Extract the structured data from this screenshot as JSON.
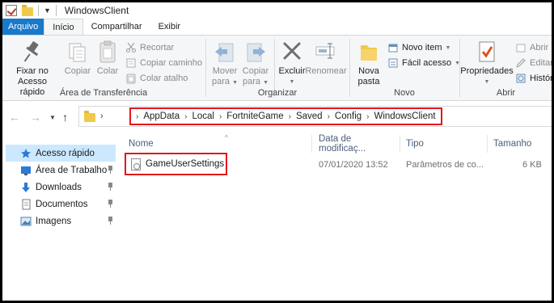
{
  "window": {
    "title": "WindowsClient"
  },
  "tabs": [
    {
      "label": "Arquivo"
    },
    {
      "label": "Início"
    },
    {
      "label": "Compartilhar"
    },
    {
      "label": "Exibir"
    }
  ],
  "ribbon": {
    "clipboard": {
      "group_label": "Área de Transferência",
      "pin_label_1": "Fixar no",
      "pin_label_2": "Acesso rápido",
      "copy_label": "Copiar",
      "paste_label": "Colar",
      "cut_label": "Recortar",
      "copy_path_label": "Copiar caminho",
      "paste_shortcut_label": "Colar atalho"
    },
    "organize": {
      "group_label": "Organizar",
      "move_label_1": "Mover",
      "move_label_2": "para",
      "copyto_label_1": "Copiar",
      "copyto_label_2": "para",
      "delete_label": "Excluir",
      "rename_label": "Renomear"
    },
    "new": {
      "group_label": "Novo",
      "new_folder_label_1": "Nova",
      "new_folder_label_2": "pasta",
      "new_item_label": "Novo item",
      "easy_access_label": "Fácil acesso"
    },
    "open": {
      "group_label": "Abrir",
      "properties_label": "Propriedades",
      "open_label": "Abrir",
      "edit_label": "Editar",
      "history_label": "Históri"
    }
  },
  "address": {
    "crumbs": [
      "AppData",
      "Local",
      "FortniteGame",
      "Saved",
      "Config",
      "WindowsClient"
    ]
  },
  "nav_pane": {
    "items": [
      {
        "label": "Acesso rápido",
        "icon": "star-icon"
      },
      {
        "label": "Área de Trabalho",
        "icon": "desktop-icon"
      },
      {
        "label": "Downloads",
        "icon": "download-arrow-icon"
      },
      {
        "label": "Documentos",
        "icon": "document-icon"
      },
      {
        "label": "Imagens",
        "icon": "pictures-icon"
      }
    ]
  },
  "file_list": {
    "columns": [
      "Nome",
      "Data de modificaç...",
      "Tipo",
      "Tamanho"
    ],
    "rows": [
      {
        "name": "GameUserSettings",
        "modified": "07/01/2020 13:52",
        "type": "Parâmetros de co...",
        "size": "6 KB"
      }
    ]
  },
  "colors": {
    "accent": "#1979ca",
    "highlight_box": "#e3161c",
    "selected": "#cce8ff"
  }
}
